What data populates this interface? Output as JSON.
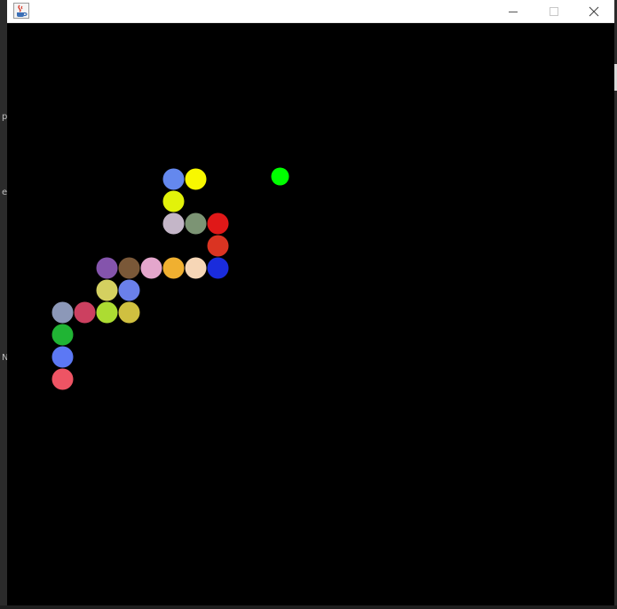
{
  "window": {
    "title": "",
    "controls": [
      "minimize",
      "maximize",
      "close"
    ],
    "icon": "java-coffee-cup-icon"
  },
  "desktop": {
    "edge_glyphs": [
      "p",
      "e",
      "N"
    ]
  },
  "game": {
    "background": "#000000",
    "grid_cell": 25,
    "food": {
      "col": 12,
      "row": 7,
      "color": "#00ff00"
    },
    "snake": [
      {
        "col": 7,
        "row": 7,
        "color": "#6488ee"
      },
      {
        "col": 8,
        "row": 7,
        "color": "#f8f800"
      },
      {
        "col": 7,
        "row": 8,
        "color": "#e2f20a"
      },
      {
        "col": 7,
        "row": 9,
        "color": "#c4b6c8"
      },
      {
        "col": 8,
        "row": 9,
        "color": "#7c9474"
      },
      {
        "col": 9,
        "row": 9,
        "color": "#e01818"
      },
      {
        "col": 9,
        "row": 10,
        "color": "#da3422"
      },
      {
        "col": 9,
        "row": 11,
        "color": "#1a2cdc"
      },
      {
        "col": 8,
        "row": 11,
        "color": "#f6d6b6"
      },
      {
        "col": 7,
        "row": 11,
        "color": "#f0b030"
      },
      {
        "col": 6,
        "row": 11,
        "color": "#e4a6cc"
      },
      {
        "col": 5,
        "row": 11,
        "color": "#7a5838"
      },
      {
        "col": 4,
        "row": 11,
        "color": "#8454ac"
      },
      {
        "col": 4,
        "row": 12,
        "color": "#d4d060"
      },
      {
        "col": 5,
        "row": 12,
        "color": "#6a80ea"
      },
      {
        "col": 5,
        "row": 13,
        "color": "#d0c040"
      },
      {
        "col": 4,
        "row": 13,
        "color": "#acdc32"
      },
      {
        "col": 3,
        "row": 13,
        "color": "#cc4060"
      },
      {
        "col": 2,
        "row": 13,
        "color": "#8c98b8"
      },
      {
        "col": 2,
        "row": 14,
        "color": "#20b434"
      },
      {
        "col": 2,
        "row": 15,
        "color": "#5c78f4"
      },
      {
        "col": 2,
        "row": 16,
        "color": "#ee5464"
      }
    ]
  }
}
